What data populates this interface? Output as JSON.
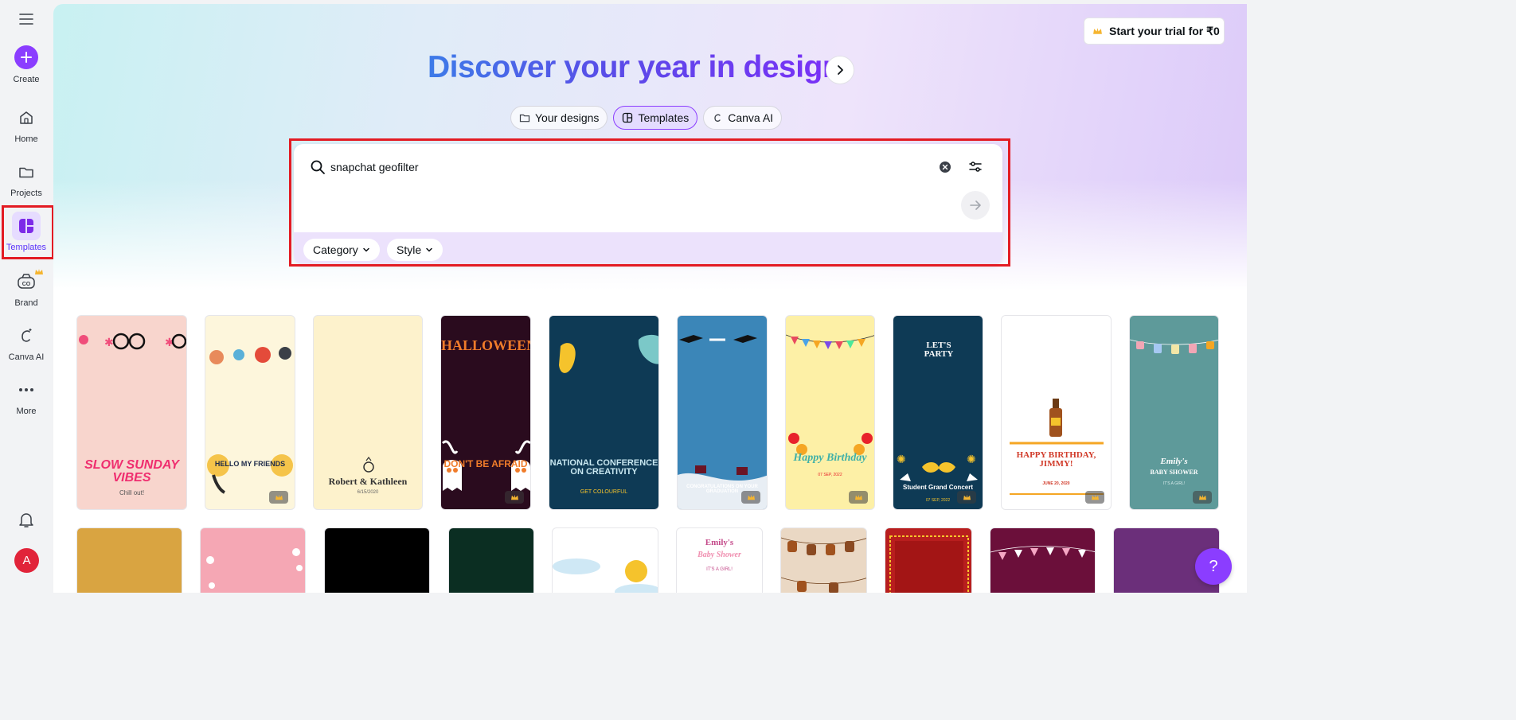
{
  "sidebar": {
    "create": "Create",
    "items": [
      {
        "label": "Home"
      },
      {
        "label": "Projects"
      },
      {
        "label": "Templates"
      },
      {
        "label": "Brand"
      },
      {
        "label": "Canva AI"
      },
      {
        "label": "More"
      }
    ],
    "avatar_letter": "A"
  },
  "header": {
    "trial_label": "Start your trial for ₹0",
    "headline": "Discover your year in design"
  },
  "tabs": [
    {
      "label": "Your designs"
    },
    {
      "label": "Templates"
    },
    {
      "label": "Canva AI"
    }
  ],
  "search": {
    "value": "snapchat geofilter",
    "filters": [
      {
        "label": "Category"
      },
      {
        "label": "Style"
      }
    ]
  },
  "templates": [
    {
      "title": "SLOW SUNDAY VIBES",
      "subtitle": "Chill out!"
    },
    {
      "title": "HELLO MY FRIENDS"
    },
    {
      "title": "Robert & Kathleen",
      "subtitle": "6/15/2020"
    },
    {
      "title": "HALLOWEEN",
      "subtitle": "DON'T BE AFRAID"
    },
    {
      "title": "NATIONAL CONFERENCE ON CREATIVITY",
      "subtitle": "GET COLOURFUL"
    },
    {
      "title": "CONGRATULATIONS ON YOUR GRADUATION"
    },
    {
      "title": "Happy Birthday",
      "subtitle": "07 SEP, 2022"
    },
    {
      "title": "LET'S PARTY",
      "subtitle": "Student Grand Concert",
      "date": "07 SEP, 2022"
    },
    {
      "title": "HAPPY BIRTHDAY, JIMMY!",
      "subtitle": "JUNE 20, 2020"
    },
    {
      "title": "Emily's",
      "subtitle": "BABY SHOWER",
      "note": "IT'S A GIRL!"
    },
    {
      "title": "Emily's",
      "subtitle": "Baby Shower",
      "note": "IT'S A GIRL!"
    }
  ],
  "help_label": "?",
  "colors": {
    "accent": "#8b3dff",
    "highlight": "#e31b23"
  }
}
